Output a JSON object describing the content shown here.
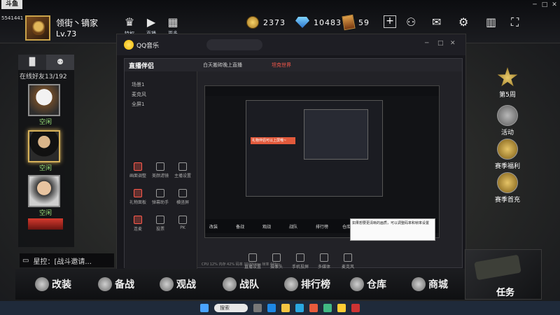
{
  "corner": {
    "logo_text": "斗鱼",
    "user_id": "5541441"
  },
  "player": {
    "name": "领街丶镝家",
    "level": "Lv.73"
  },
  "top_nav": [
    {
      "label": "特权",
      "icon": "crown-icon"
    },
    {
      "label": "直播",
      "icon": "play-tv-icon"
    },
    {
      "label": "更多",
      "icon": "grid-icon"
    }
  ],
  "resources": {
    "gold": "2373",
    "diamonds": "10483",
    "cards": "59"
  },
  "left_panel": {
    "online_count": "在线好友13/192",
    "friends": [
      {
        "status": "空闲",
        "name": "eagle-avatar"
      },
      {
        "status": "空闲",
        "name": "suit-avatar"
      },
      {
        "status": "空闲",
        "name": "boy-avatar"
      }
    ]
  },
  "chat": {
    "message": "星控：[战斗邀请..."
  },
  "right_menu": [
    {
      "label": "第5周"
    },
    {
      "label": "活动"
    },
    {
      "label": "赛季福利"
    },
    {
      "label": "赛季首充"
    }
  ],
  "bottom_nav": [
    {
      "label": "改装"
    },
    {
      "label": "备战"
    },
    {
      "label": "观战"
    },
    {
      "label": "战队"
    },
    {
      "label": "排行榜"
    },
    {
      "label": "仓库"
    },
    {
      "label": "商城"
    }
  ],
  "mission_button": {
    "label": "任务"
  },
  "qq_window": {
    "app_name": "QQ音乐",
    "streaming": {
      "app_name": "直播伴侣",
      "topic": "白天搬砖晚上直播",
      "channel_label": "坦克世界",
      "overlay_text": "礼物伴侣可以上屏哦~",
      "toolbar": [
        "直播设置",
        "摄像头",
        "手机投屏",
        "多媒体",
        "麦克风"
      ],
      "side_tools": [
        "画面调整",
        "美颜滤镜",
        "主播设置",
        "礼物面板",
        "弹幕助手",
        "横竖屏",
        "连麦",
        "投票",
        "PK"
      ],
      "preview_tabs": [
        "改装",
        "备战",
        "观战",
        "战队",
        "排行榜",
        "仓库",
        "商城"
      ],
      "tip_text": "如果想要更清晰的画质，可以调整码率和帧率设置",
      "side_items": [
        "场景1",
        "麦克风",
        "全屏1"
      ],
      "status_text": "CPU 12%  内存 42%  码率 3500kbps  帧率 60fps"
    }
  },
  "taskbar": {
    "search_placeholder": "搜索"
  }
}
